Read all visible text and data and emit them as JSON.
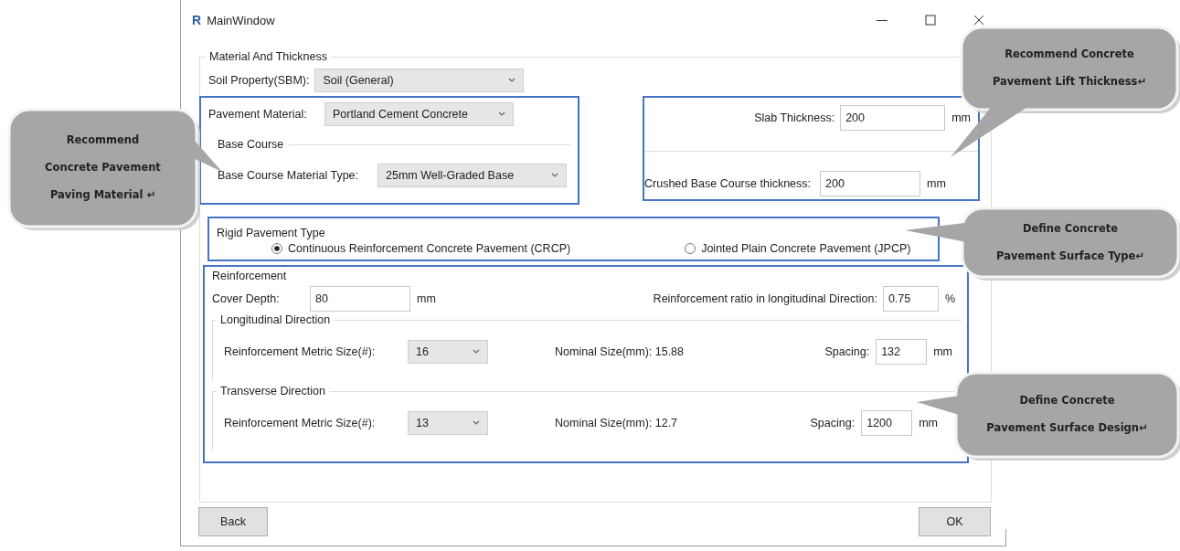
{
  "window": {
    "app_icon": "R",
    "title": "MainWindow"
  },
  "material_and_thickness": {
    "title": "Material And Thickness",
    "soil_property": {
      "label": "Soil Property(SBM):",
      "value": "Soil (General)"
    },
    "pavement_material": {
      "label": "Pavement Material:",
      "value": "Portland Cement Concrete"
    },
    "base_course": {
      "title": "Base Course",
      "material_type": {
        "label": "Base Course Material Type:",
        "value": "25mm Well-Graded Base"
      }
    },
    "slab_thickness": {
      "label": "Slab Thickness:",
      "value": "200",
      "unit": "mm"
    },
    "crushed_base_thickness": {
      "label": "Crushed Base Course thickness:",
      "value": "200",
      "unit": "mm"
    }
  },
  "rigid_pavement_type": {
    "title": "Rigid Pavement Type",
    "options": [
      {
        "label": "Continuous Reinforcement Concrete Pavement (CRCP)",
        "selected": true
      },
      {
        "label": "Jointed Plain Concrete Pavement (JPCP)",
        "selected": false
      }
    ]
  },
  "reinforcement": {
    "title": "Reinforcement",
    "cover_depth": {
      "label": "Cover Depth:",
      "value": "80",
      "unit": "mm"
    },
    "ratio": {
      "label": "Reinforcement ratio in longitudinal Direction:",
      "value": "0.75",
      "unit": "%"
    },
    "directions": [
      {
        "title": "Longitudinal Direction",
        "size_label": "Reinforcement Metric Size(#):",
        "size_value": "16",
        "nominal": "Nominal Size(mm): 15.88",
        "spacing_label": "Spacing:",
        "spacing_value": "132",
        "spacing_unit": "mm"
      },
      {
        "title": "Transverse Direction",
        "size_label": "Reinforcement Metric Size(#):",
        "size_value": "13",
        "nominal": "Nominal Size(mm): 12.7",
        "spacing_label": "Spacing:",
        "spacing_value": "1200",
        "spacing_unit": "mm"
      }
    ]
  },
  "buttons": [
    {
      "label": "Back"
    },
    {
      "label": "OK"
    }
  ],
  "annotations": [
    {
      "lines": [
        "Recommend",
        "Concrete Pavement",
        "Paving Material ↵"
      ]
    },
    {
      "lines": [
        "Recommend Concrete",
        "Pavement Lift Thickness↵"
      ]
    },
    {
      "lines": [
        "Define Concrete",
        "Pavement Surface Type↵"
      ]
    },
    {
      "lines": [
        "Define Concrete",
        "Pavement Surface Design↵"
      ]
    }
  ]
}
